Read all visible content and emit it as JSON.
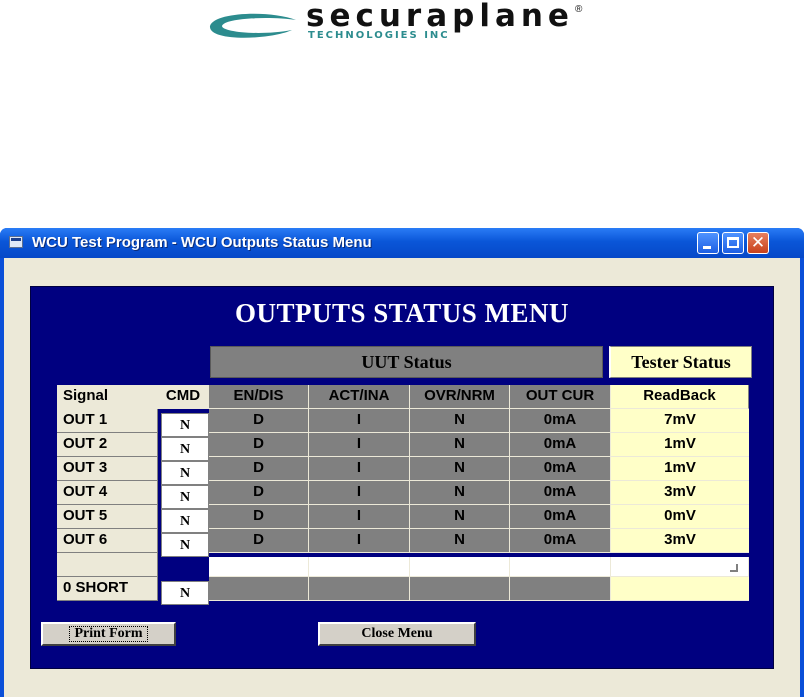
{
  "logo": {
    "wordmark": "securaplane",
    "registered": "®",
    "subtitle": "TECHNOLOGIES INC",
    "swoosh_color": "#2c8c8e"
  },
  "window": {
    "title": "WCU Test Program - WCU Outputs Status Menu",
    "controls": {
      "minimize": "minimize-icon",
      "maximize": "maximize-icon",
      "close": "✕"
    }
  },
  "menu": {
    "title": "OUTPUTS STATUS MENU",
    "uut_status_label": "UUT Status",
    "tester_status_label": "Tester Status"
  },
  "table": {
    "headers": [
      "Signal",
      "CMD",
      "EN/DIS",
      "ACT/INA",
      "OVR/NRM",
      "OUT CUR",
      "ReadBack"
    ],
    "rows": [
      {
        "signal": "OUT 1",
        "cmd": "N",
        "en_dis": "D",
        "act_ina": "I",
        "ovr_nrm": "N",
        "out_cur": "0mA",
        "readback": "7mV"
      },
      {
        "signal": "OUT 2",
        "cmd": "N",
        "en_dis": "D",
        "act_ina": "I",
        "ovr_nrm": "N",
        "out_cur": "0mA",
        "readback": "1mV"
      },
      {
        "signal": "OUT 3",
        "cmd": "N",
        "en_dis": "D",
        "act_ina": "I",
        "ovr_nrm": "N",
        "out_cur": "0mA",
        "readback": "1mV"
      },
      {
        "signal": "OUT 4",
        "cmd": "N",
        "en_dis": "D",
        "act_ina": "I",
        "ovr_nrm": "N",
        "out_cur": "0mA",
        "readback": "3mV"
      },
      {
        "signal": "OUT 5",
        "cmd": "N",
        "en_dis": "D",
        "act_ina": "I",
        "ovr_nrm": "N",
        "out_cur": "0mA",
        "readback": "0mV"
      },
      {
        "signal": "OUT 6",
        "cmd": "N",
        "en_dis": "D",
        "act_ina": "I",
        "ovr_nrm": "N",
        "out_cur": "0mA",
        "readback": "3mV"
      }
    ],
    "short_row": {
      "signal": "0 SHORT",
      "cmd": "N"
    }
  },
  "buttons": {
    "print_form": "Print Form",
    "close_menu": "Close Menu"
  },
  "colors": {
    "panel": "#000080",
    "uut_gray": "#808080",
    "tester_yellow": "#ffffc8",
    "titlebar": "#0a56d8"
  }
}
